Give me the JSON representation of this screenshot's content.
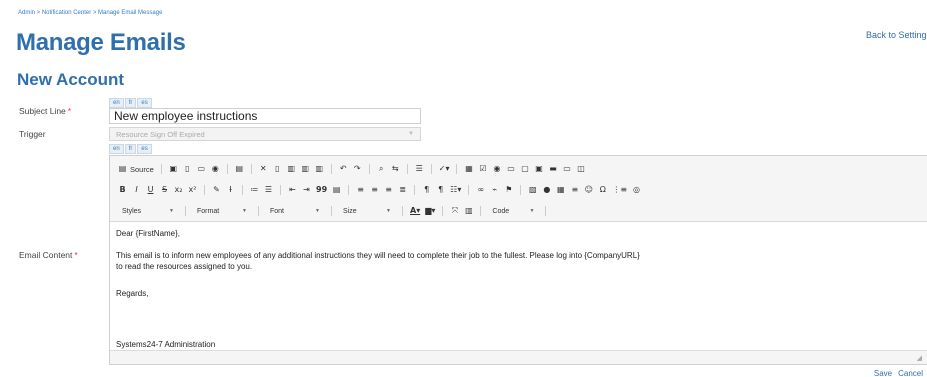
{
  "breadcrumb": "Admin > Notification Center > Manage Email Message",
  "page_title": "Manage Emails",
  "back_link": "Back to Settings",
  "section_title": "New Account",
  "languages": [
    "en",
    "fr",
    "es"
  ],
  "subject": {
    "label": "Subject Line",
    "required": "*",
    "value": "New employee instructions"
  },
  "trigger": {
    "label": "Trigger",
    "value": "Resource Sign Off Expired"
  },
  "email_content": {
    "label": "Email Content",
    "required": "*"
  },
  "toolbar": {
    "source_label": "Source",
    "styles": "Styles",
    "format": "Format",
    "font": "Font",
    "size": "Size",
    "code": "Code",
    "bold": "B",
    "italic": "I",
    "underline": "U",
    "strike": "S",
    "quote": "99"
  },
  "body": {
    "greeting": "Dear {FirstName},",
    "para1_line1": "This email is to inform new employees of any additional instructions they will need to complete their job to the fullest. Please log into {CompanyURL}",
    "para1_line2": "to read the resources assigned to you.",
    "regards": "Regards,",
    "signature": "Systems24-7 Administration"
  },
  "actions": {
    "save": "Save",
    "cancel": "Cancel"
  },
  "colors": {
    "accent": "#2f6fae",
    "required": "#e04040"
  }
}
